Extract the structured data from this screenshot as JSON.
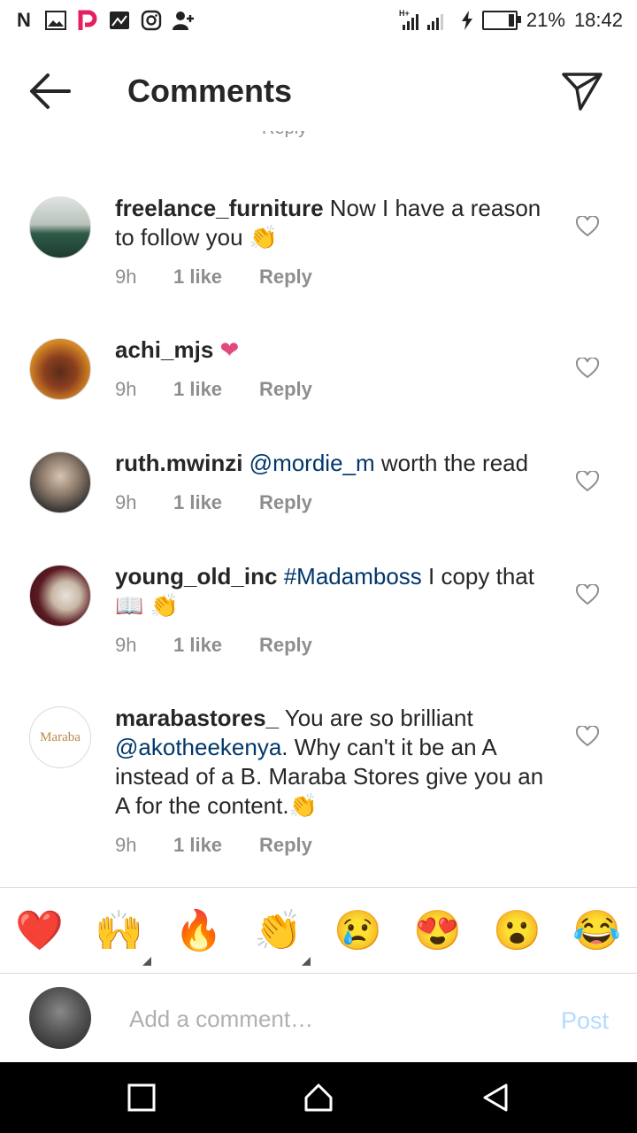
{
  "status_bar": {
    "battery": "21%",
    "time": "18:42"
  },
  "header": {
    "title": "Comments"
  },
  "peek_text": "Reply",
  "comments": [
    {
      "username": "freelance_furniture",
      "text": "Now I have a reason to follow you 👏",
      "time": "9h",
      "likes": "1 like",
      "reply": "Reply"
    },
    {
      "username": "achi_mjs",
      "text": "❤",
      "time": "9h",
      "likes": "1 like",
      "reply": "Reply"
    },
    {
      "username": "ruth.mwinzi",
      "mention": "@mordie_m",
      "text": "worth the read",
      "time": "9h",
      "likes": "1 like",
      "reply": "Reply"
    },
    {
      "username": "young_old_inc",
      "hashtag": "#Madamboss",
      "text": "I copy that 📖 👏",
      "time": "9h",
      "likes": "1 like",
      "reply": "Reply"
    },
    {
      "username": "marabastores_",
      "text_a": "You are so brilliant",
      "mention": "@akotheekenya",
      "text_b": ". Why can't it be an A instead of a B. Maraba Stores give you an A for the content.👏",
      "avatar_label": "Maraba",
      "time": "9h",
      "likes": "1 like",
      "reply": "Reply"
    }
  ],
  "emoji_bar": [
    "❤️",
    "🙌",
    "🔥",
    "👏",
    "😢",
    "😍",
    "😮",
    "😂"
  ],
  "input": {
    "placeholder": "Add a comment…",
    "post_label": "Post"
  }
}
